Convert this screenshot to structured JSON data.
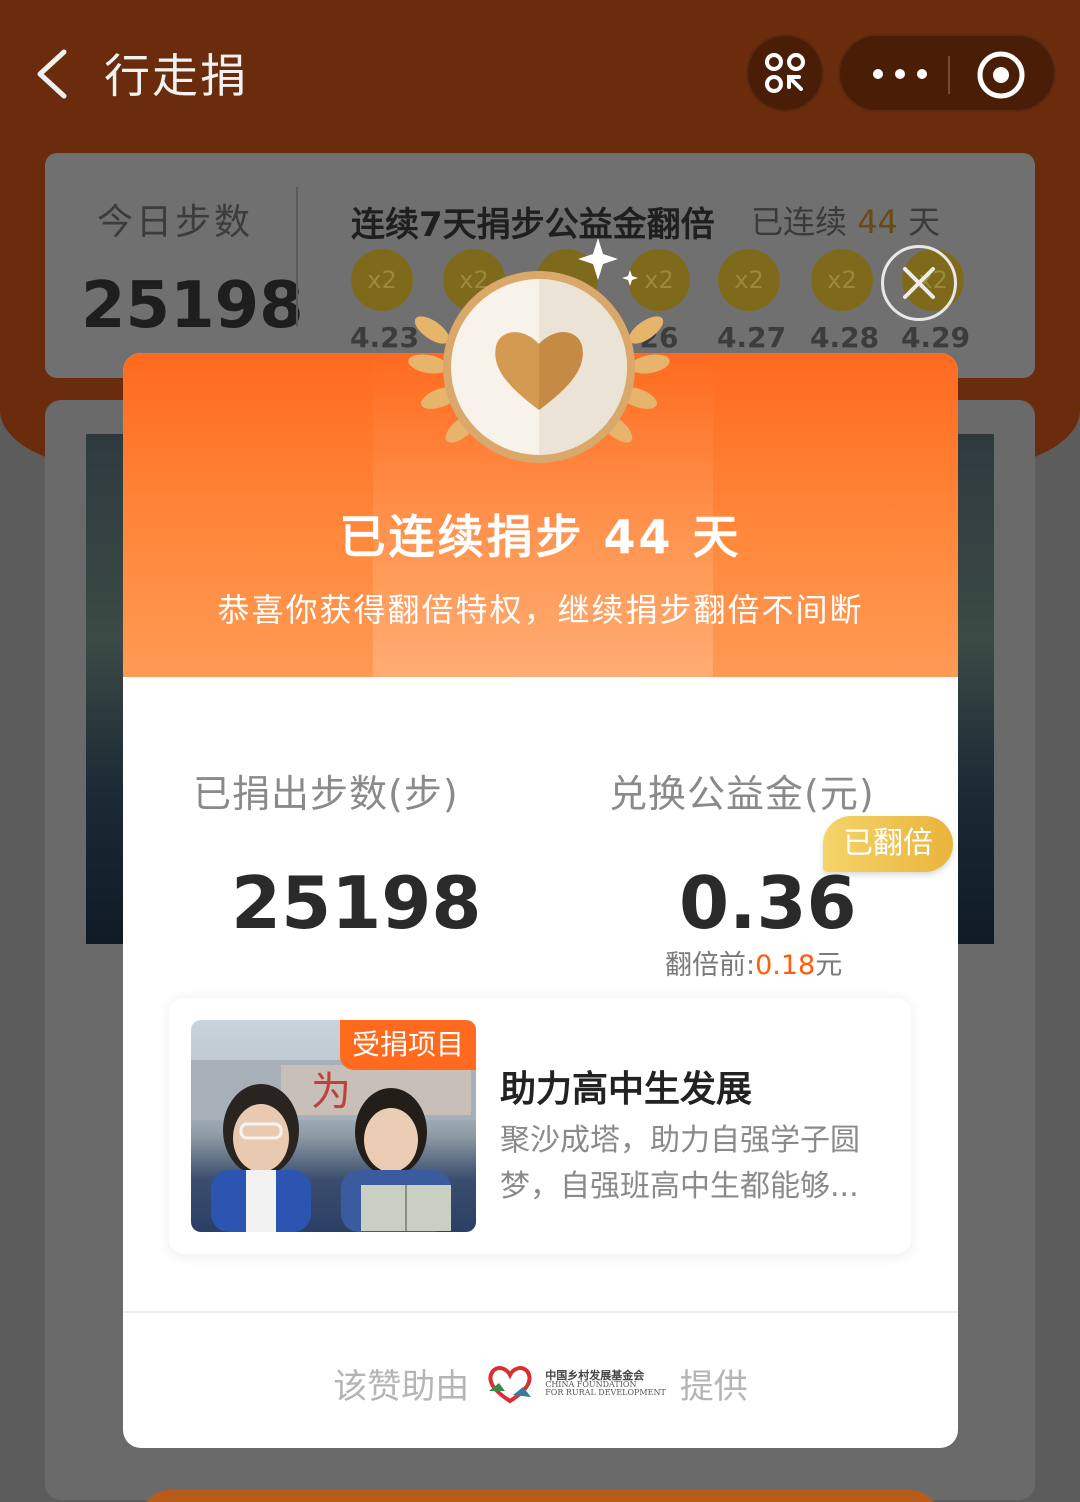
{
  "nav": {
    "title": "行走捐"
  },
  "steps_card": {
    "today_label": "今日步数",
    "today_value": "25198",
    "streak_title": "连续7天捐步公益金翻倍",
    "streak_prefix": "已连续",
    "streak_days": "44",
    "streak_suffix": "天",
    "days": [
      {
        "mark": "x2",
        "date": "4.23"
      },
      {
        "mark": "x2",
        "date": ""
      },
      {
        "mark": "",
        "date": ""
      },
      {
        "mark": "x2",
        "date": "26"
      },
      {
        "mark": "x2",
        "date": "4.27"
      },
      {
        "mark": "x2",
        "date": "4.28"
      },
      {
        "mark": "x2",
        "date": "4.29"
      }
    ]
  },
  "modal": {
    "title": "已连续捐步 44 天",
    "subtitle": "恭喜你获得翻倍特权，继续捐步翻倍不间断",
    "steps_label": "已捐出步数(步)",
    "steps_value": "25198",
    "money_label": "兑换公益金(元)",
    "money_value": "0.36",
    "doubled_badge": "已翻倍",
    "before_prefix": "翻倍前:",
    "before_amount": "0.18",
    "before_unit": "元",
    "project": {
      "tag": "受捐项目",
      "title": "助力高中生发展",
      "description": "聚沙成塔，助力自强学子圆梦，自强班高中生都能够..."
    },
    "sponsor": {
      "prefix": "该赞助由",
      "logo_cn": "中国乡村发展基金会",
      "logo_en_1": "CHINA FOUNDATION",
      "logo_en_2": "FOR RURAL DEVELOPMENT",
      "suffix": "提供"
    }
  },
  "colors": {
    "brand_orange": "#ff6a1f",
    "accent_red_orange": "#ff5c0c",
    "badge_gold": "#e9b43c"
  },
  "icons": {
    "back": "chevron-left-icon",
    "scan": "scan-icon",
    "more": "more-dots-icon",
    "miniapp_close": "target-icon",
    "overlay_close": "close-icon",
    "medal": "heart-medal-icon"
  }
}
